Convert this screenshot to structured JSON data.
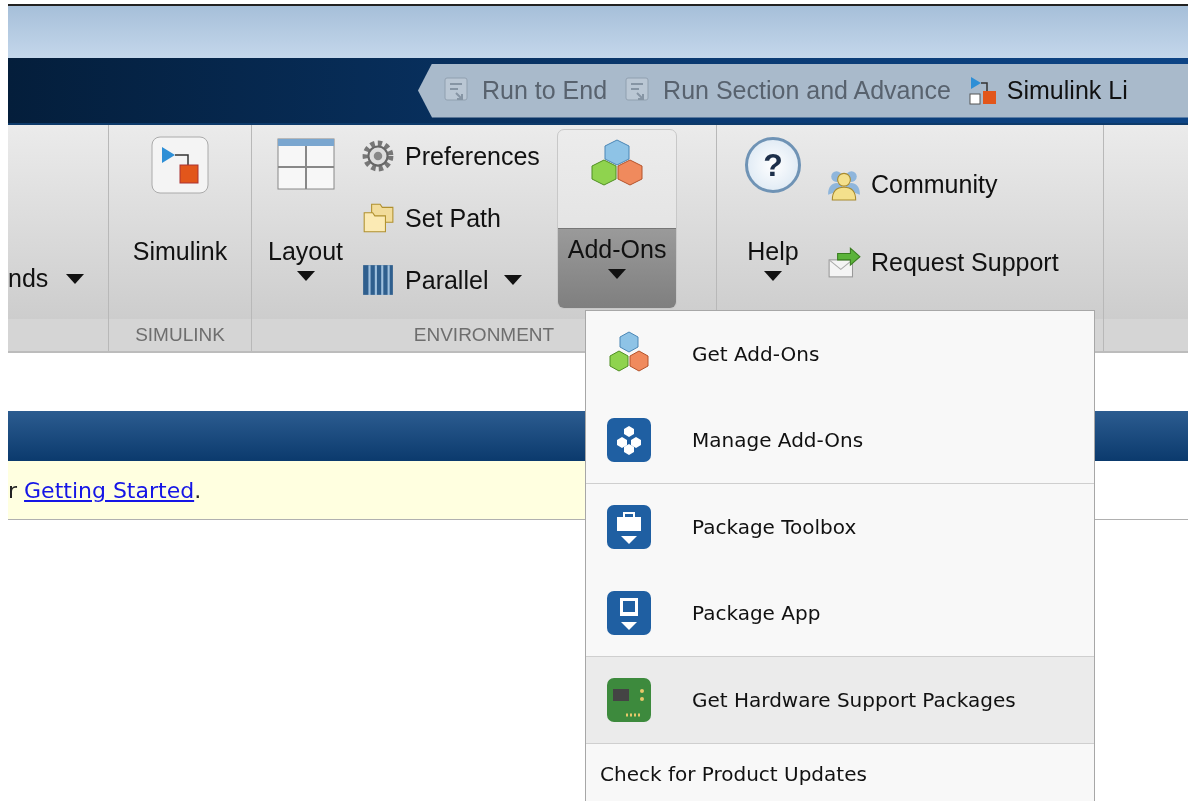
{
  "quick_access": [
    {
      "label": "Run to End",
      "disabled": true
    },
    {
      "label": "Run Section and Advance",
      "disabled": true
    },
    {
      "label": "Simulink Li",
      "disabled": false
    }
  ],
  "ribbon": {
    "cut_button": {
      "label": "nds"
    },
    "simulink_section": {
      "label": "SIMULINK",
      "button": "Simulink"
    },
    "environment_section": {
      "label": "ENVIRONMENT",
      "layout": "Layout",
      "small_buttons": [
        "Preferences",
        "Set Path",
        "Parallel"
      ],
      "addons": {
        "label": "Add-Ons",
        "pressed": true
      }
    },
    "help_section": {
      "icon_glyph": "?",
      "help": "Help",
      "small_buttons": [
        "Community",
        "Request Support"
      ]
    }
  },
  "banner": {
    "prefix": "r",
    "link": "Getting Started",
    "suffix": "."
  },
  "menu": {
    "groups": [
      [
        {
          "kind": "icon",
          "label": "Get Add-Ons",
          "selected": false
        },
        {
          "kind": "icon",
          "label": "Manage Add-Ons",
          "selected": false
        }
      ],
      [
        {
          "kind": "icon",
          "label": "Package Toolbox",
          "selected": false
        },
        {
          "kind": "icon",
          "label": "Package App",
          "selected": false
        }
      ],
      [
        {
          "kind": "icon",
          "label": "Get Hardware Support Packages",
          "selected": true
        }
      ],
      [
        {
          "kind": "plain",
          "label": "Check for Product Updates",
          "selected": false
        }
      ]
    ]
  }
}
